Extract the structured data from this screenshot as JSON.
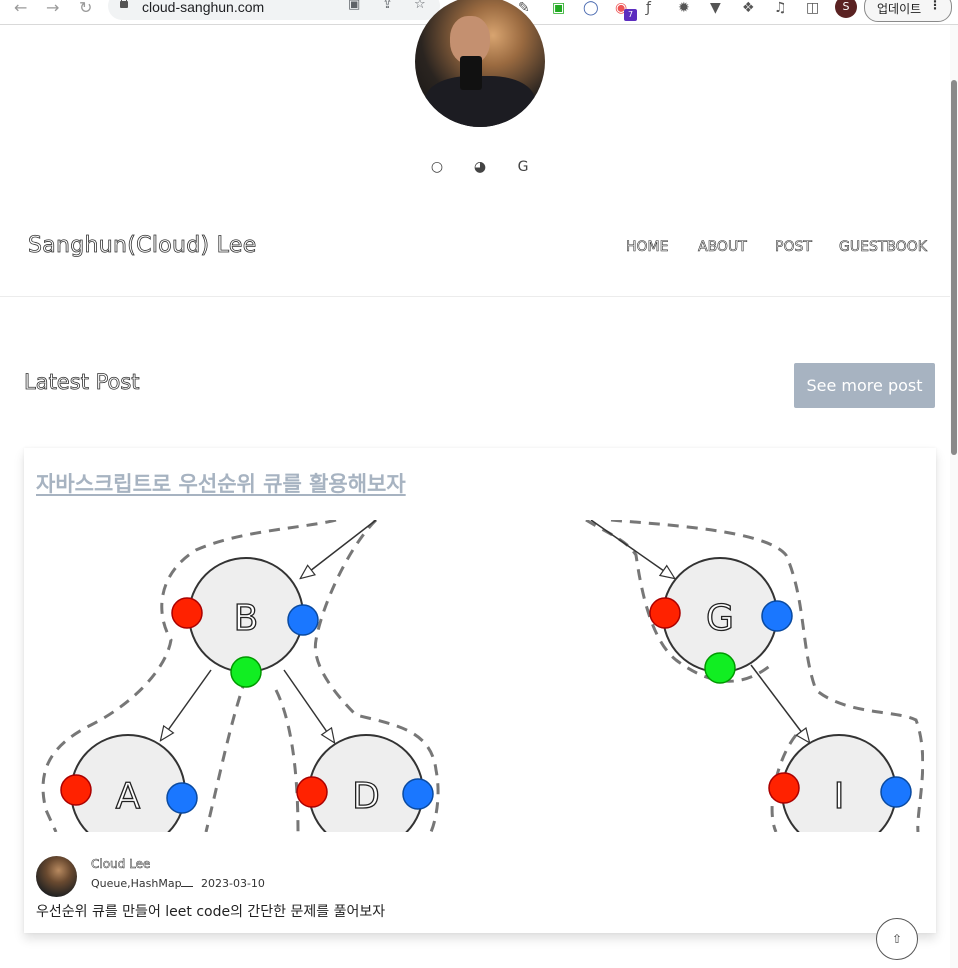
{
  "browser": {
    "url": "cloud-sanghun.com",
    "update_label": "업데이트",
    "profile_initial": "S",
    "ext_badge": "7"
  },
  "blog": {
    "title": "Sanghun(Cloud) Lee",
    "nav": [
      "HOME",
      "ABOUT",
      "POST",
      "GUESTBOOK"
    ],
    "social_icons": [
      "instagram-icon",
      "github-icon",
      "google-icon"
    ]
  },
  "latest": {
    "heading": "Latest Post",
    "see_more_label": "See more post"
  },
  "post": {
    "title": "자바스크립트로 우선순위 큐를 활용해보자",
    "author": "Cloud Lee",
    "tags": "Queue,HashMap",
    "date": "2023-03-10",
    "description": "우선순위 큐를 만들어 leet code의 간단한 문제를 풀어보자",
    "diagram_nodes": [
      "B",
      "G",
      "A",
      "D",
      "I"
    ]
  },
  "colors": {
    "button_bg": "#a7b3c1",
    "node_red": "#ff2200",
    "node_blue": "#1a77ff",
    "node_green": "#11ee22"
  }
}
